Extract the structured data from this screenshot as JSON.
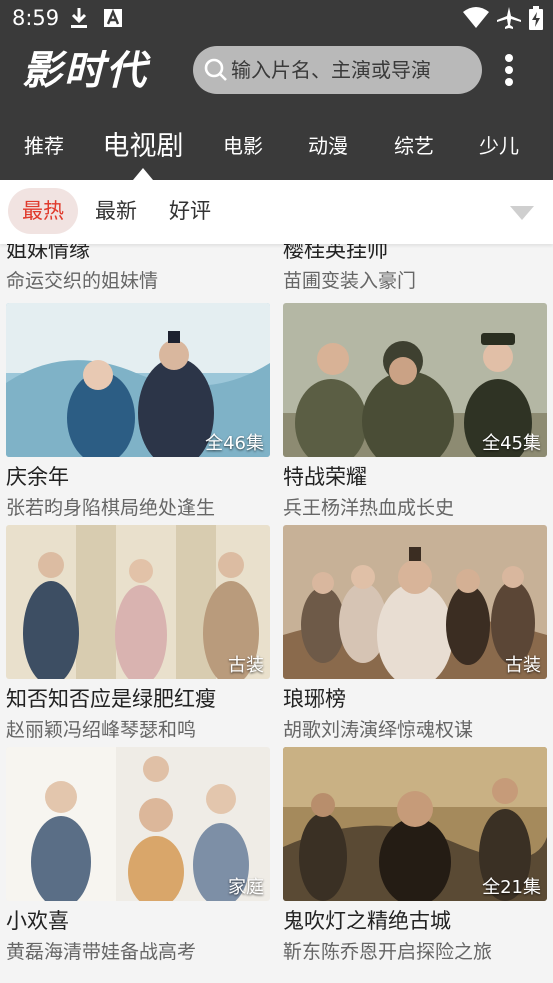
{
  "status_bar": {
    "time": "8:59",
    "left_icons": [
      "download-icon",
      "font-icon"
    ],
    "right_icons": [
      "wifi-icon",
      "airplane-icon",
      "battery-charging-icon"
    ]
  },
  "header": {
    "logo_text": "影时代",
    "search_placeholder": "输入片名、主演或导演",
    "colors": {
      "background": "#3a3a3a",
      "search_bg": "#b9b9b9"
    }
  },
  "tabs": [
    {
      "label": "推荐",
      "active": false
    },
    {
      "label": "电视剧",
      "active": true
    },
    {
      "label": "电影",
      "active": false
    },
    {
      "label": "动漫",
      "active": false
    },
    {
      "label": "综艺",
      "active": false
    },
    {
      "label": "少儿",
      "active": false
    }
  ],
  "filters": [
    {
      "label": "最热",
      "active": true
    },
    {
      "label": "最新",
      "active": false
    },
    {
      "label": "好评",
      "active": false
    }
  ],
  "accent_color": "#e03a2c",
  "partial_row": [
    {
      "title": "姐妹情缘",
      "subtitle": "命运交织的姐妹情"
    },
    {
      "title": "樱桂英挂帅",
      "subtitle": "苗圃变装入豪门"
    }
  ],
  "items": [
    {
      "title": "庆余年",
      "subtitle": "张若昀身陷棋局绝处逢生",
      "badge": "全46集",
      "palette": [
        "#9cc7d9",
        "#e4eef1",
        "#2c3548"
      ]
    },
    {
      "title": "特战荣耀",
      "subtitle": "兵王杨洋热血成长史",
      "badge": "全45集",
      "palette": [
        "#b4b7a4",
        "#5b5e44",
        "#2f3324"
      ]
    },
    {
      "title": "知否知否应是绿肥红瘦",
      "subtitle": "赵丽颖冯绍峰琴瑟和鸣",
      "badge": "古装",
      "palette": [
        "#e9e0cc",
        "#b99b7c",
        "#3d4e63"
      ]
    },
    {
      "title": "琅琊榜",
      "subtitle": "胡歌刘涛演绎惊魂权谋",
      "badge": "古装",
      "palette": [
        "#c7b197",
        "#8a6a4c",
        "#3b2d22"
      ]
    },
    {
      "title": "小欢喜",
      "subtitle": "黄磊海清带娃备战高考",
      "badge": "家庭",
      "palette": [
        "#efece6",
        "#d9a66a",
        "#5a6e86"
      ]
    },
    {
      "title": "鬼吹灯之精绝古城",
      "subtitle": "靳东陈乔恩开启探险之旅",
      "badge": "全21集",
      "palette": [
        "#a58a5c",
        "#5a4a34",
        "#241c14"
      ]
    }
  ]
}
